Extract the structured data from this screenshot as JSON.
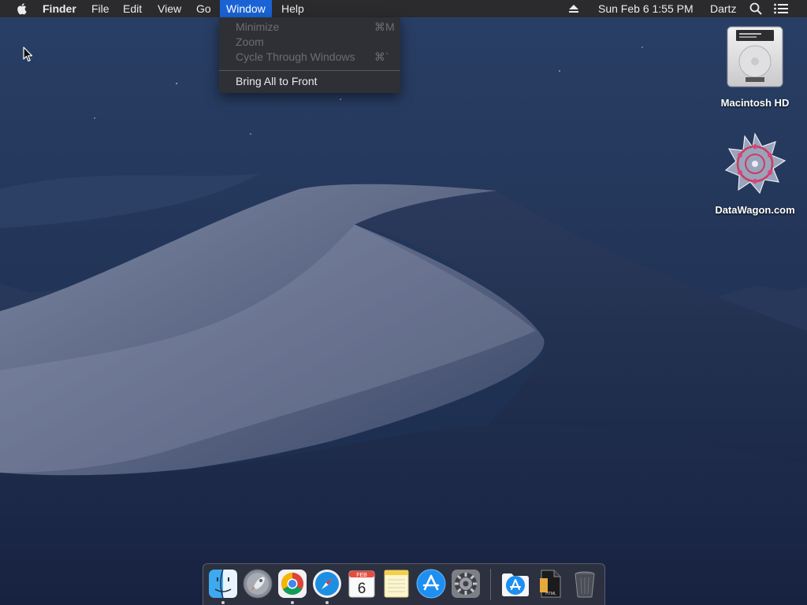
{
  "menubar": {
    "app_name": "Finder",
    "menus": [
      "File",
      "Edit",
      "View",
      "Go",
      "Window",
      "Help"
    ],
    "active_menu": "Window",
    "clock": "Sun Feb 6  1:55 PM",
    "user": "Dartz",
    "icons": [
      "apple-icon",
      "eject-icon",
      "spotlight-search-icon",
      "notification-center-icon"
    ]
  },
  "window_menu": {
    "items": [
      {
        "label": "Minimize",
        "shortcut": "⌘M",
        "enabled": false
      },
      {
        "label": "Zoom",
        "shortcut": "",
        "enabled": false
      },
      {
        "label": "Cycle Through Windows",
        "shortcut": "⌘`",
        "enabled": false
      },
      {
        "label": "Bring All to Front",
        "shortcut": "",
        "enabled": true
      }
    ]
  },
  "desktop": {
    "icons": [
      {
        "label": "Macintosh HD",
        "icon": "hard-drive-icon"
      },
      {
        "label": "DataWagon.com",
        "icon": "datawagon-logo-icon"
      }
    ]
  },
  "dock": {
    "apps": [
      {
        "name": "Finder",
        "icon": "finder-icon",
        "running": true
      },
      {
        "name": "Launchpad",
        "icon": "launchpad-icon",
        "running": false
      },
      {
        "name": "Google Chrome",
        "icon": "chrome-icon",
        "running": true
      },
      {
        "name": "Safari",
        "icon": "safari-icon",
        "running": true
      },
      {
        "name": "Calendar",
        "icon": "calendar-icon",
        "running": false
      },
      {
        "name": "Notes",
        "icon": "notes-icon",
        "running": false
      },
      {
        "name": "App Store",
        "icon": "app-store-icon",
        "running": false
      },
      {
        "name": "System Preferences",
        "icon": "system-preferences-icon",
        "running": false
      },
      {
        "name": "Applications",
        "icon": "applications-folder-icon",
        "running": false
      },
      {
        "name": "HTML Document",
        "icon": "html-file-icon",
        "running": false
      },
      {
        "name": "Trash",
        "icon": "trash-icon",
        "running": false
      }
    ],
    "calendar": {
      "month": "FEB",
      "day": "6"
    },
    "html_file_tag": "HTML"
  },
  "colors": {
    "menubar": "#2b2b2d",
    "menu_highlight": "#1a63d6",
    "disabled_text": "#6d6d70",
    "sky": "#1b2b4d"
  }
}
